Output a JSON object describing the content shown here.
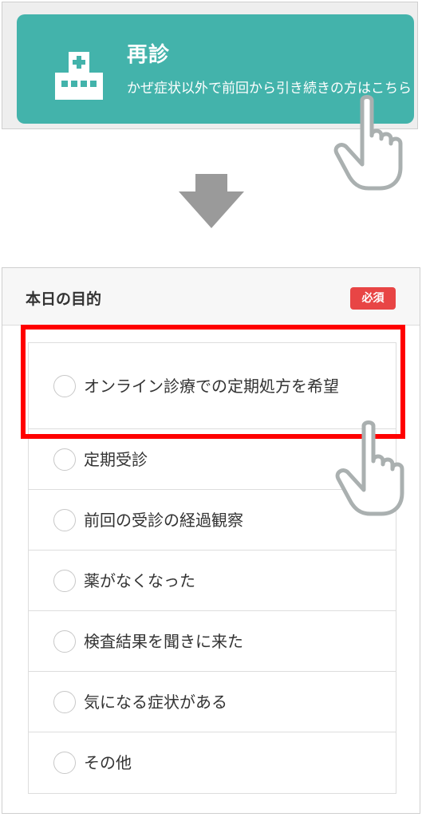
{
  "revisit": {
    "title": "再診",
    "description": "かぜ症状以外で前回から引き続きの方はこちら"
  },
  "form": {
    "title": "本日の目的",
    "required_label": "必須",
    "options": [
      {
        "label": "オンライン診療での定期処方を希望"
      },
      {
        "label": "定期受診"
      },
      {
        "label": "前回の受診の経過観察"
      },
      {
        "label": "薬がなくなった"
      },
      {
        "label": "検査結果を聞きに来た"
      },
      {
        "label": "気になる症状がある"
      },
      {
        "label": "その他"
      }
    ]
  },
  "colors": {
    "accent": "#43b3ab",
    "required": "#e84545",
    "highlight": "#ff0000"
  },
  "icons": [
    "hospital-icon",
    "pointing-hand-icon",
    "down-arrow-icon",
    "radio-circle-icon"
  ]
}
